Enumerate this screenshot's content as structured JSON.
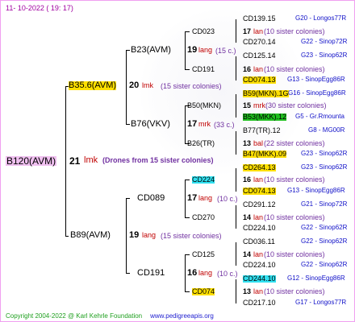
{
  "date": "11-  10-2022  ( 19:  17)",
  "footer": {
    "copyright": "Copyright 2004-2022 @ Karl Kehrle Foundation",
    "site": "www.pedigreeapis.org"
  },
  "root": {
    "code": "B120(AVM)",
    "count": "21",
    "mark": "lmk",
    "note": "(Drones from 15 sister colonies)"
  },
  "gen1": [
    {
      "code": "B35.6(AVM)",
      "count": "20",
      "mark": "lmk",
      "note": "(15 sister colonies)"
    },
    {
      "code": "B89(AVM)",
      "count": "19",
      "mark": "lang",
      "note": "(15 sister colonies)"
    }
  ],
  "gen2": [
    {
      "code": "B23(AVM)",
      "count": "19",
      "mark": "lang",
      "note": "(15 c.)"
    },
    {
      "code": "B76(VKV)",
      "count": "17",
      "mark": "mrk",
      "note": "(33 c.)"
    },
    {
      "code": "CD089",
      "count": "17",
      "mark": "lang",
      "note": "(10 c.)"
    },
    {
      "code": "CD191",
      "count": "16",
      "mark": "lang",
      "note": "(10 c.)"
    }
  ],
  "gen3": [
    {
      "code": "CD023",
      "count": "17",
      "mark": "lan",
      "note": "(10 sister colonies)"
    },
    {
      "code": "CD191",
      "count": "16",
      "mark": "lan",
      "note": "(10 sister colonies)"
    },
    {
      "code": "B50(MKN)",
      "count": "15",
      "mark": "mrk",
      "note": "(30 sister colonies)"
    },
    {
      "code": "B26(TR)",
      "count": "13",
      "mark": "bal",
      "note": "(22 sister colonies)"
    },
    {
      "code": "CD224",
      "count": "16",
      "mark": "lan",
      "note": "(10 sister colonies)"
    },
    {
      "code": "CD270",
      "count": "14",
      "mark": "lan",
      "note": "(10 sister colonies)"
    },
    {
      "code": "CD125",
      "count": "14",
      "mark": "lan",
      "note": "(10 sister colonies)"
    },
    {
      "code": "CD074",
      "count": "13",
      "mark": "lan",
      "note": "(10 sister colonies)"
    }
  ],
  "gen4": [
    {
      "code": "CD139.15",
      "label": "G20 - Longos77R"
    },
    {
      "code": "CD270.14",
      "label": "G22 - Sinop72R"
    },
    {
      "code": "CD125.14",
      "label": "G23 - Sinop62R"
    },
    {
      "code": "CD074.13",
      "label": "G13 - SinopEgg86R"
    },
    {
      "code": "B59(MKN).1G",
      "label": "G16 - SinopEgg86R"
    },
    {
      "code": "B53(MKK).12",
      "label": "G5 - Gr.Rmounta"
    },
    {
      "code": "B77(TR).12",
      "label": "G8 - MG00R"
    },
    {
      "code": "B47(MKK).09",
      "label": "G23 - Sinop62R"
    },
    {
      "code": "CD264.13",
      "label": "G23 - Sinop62R"
    },
    {
      "code": "CD074.13",
      "label": "G13 - SinopEgg86R"
    },
    {
      "code": "CD291.12",
      "label": "G21 - Sinop72R"
    },
    {
      "code": "CD224.10",
      "label": "G22 - Sinop62R"
    },
    {
      "code": "CD036.11",
      "label": "G22 - Sinop62R"
    },
    {
      "code": "CD224.10",
      "label": "G22 - Sinop62R"
    },
    {
      "code": "CD244.10",
      "label": "G12 - SinopEgg86R"
    },
    {
      "code": "CD217.10",
      "label": "G17 - Longos77R"
    }
  ]
}
